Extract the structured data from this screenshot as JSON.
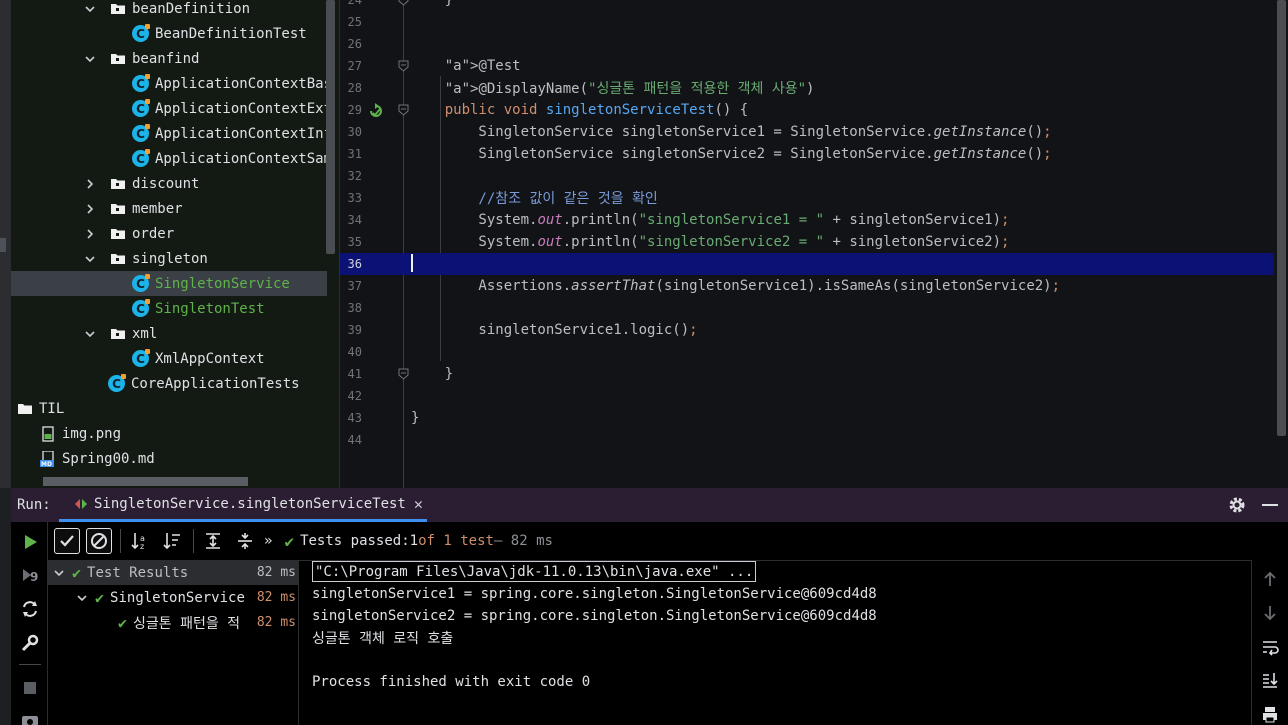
{
  "tree": {
    "items": [
      {
        "label": "beanDefinition",
        "type": "folder",
        "expanded": true,
        "indent": 1
      },
      {
        "label": "BeanDefinitionTest",
        "type": "class",
        "indent": 2
      },
      {
        "label": "beanfind",
        "type": "folder",
        "expanded": true,
        "indent": 1
      },
      {
        "label": "ApplicationContextBasi",
        "type": "class",
        "indent": 2
      },
      {
        "label": "ApplicationContextExte",
        "type": "class",
        "indent": 2
      },
      {
        "label": "ApplicationContextInfo",
        "type": "class",
        "indent": 2
      },
      {
        "label": "ApplicationContextSam",
        "type": "class",
        "indent": 2
      },
      {
        "label": "discount",
        "type": "folder",
        "expanded": false,
        "indent": 1
      },
      {
        "label": "member",
        "type": "folder",
        "expanded": false,
        "indent": 1
      },
      {
        "label": "order",
        "type": "folder",
        "expanded": false,
        "indent": 1
      },
      {
        "label": "singleton",
        "type": "folder",
        "expanded": true,
        "indent": 1
      },
      {
        "label": "SingletonService",
        "type": "class",
        "indent": 2,
        "green": true,
        "selected": true
      },
      {
        "label": "SingletonTest",
        "type": "class",
        "indent": 2,
        "green": true
      },
      {
        "label": "xml",
        "type": "folder",
        "expanded": true,
        "indent": 1
      },
      {
        "label": "XmlAppContext",
        "type": "class",
        "indent": 2
      },
      {
        "label": "CoreApplicationTests",
        "type": "class",
        "indent": 1.5
      },
      {
        "label": "TIL",
        "type": "rootfolder",
        "indent": 0
      },
      {
        "label": "img.png",
        "type": "image",
        "indent": 0.5
      },
      {
        "label": "Spring00.md",
        "type": "markdown",
        "indent": 0.5
      }
    ]
  },
  "editor": {
    "current_line": "36",
    "lines": [
      {
        "n": "24",
        "code": "    }"
      },
      {
        "n": "25",
        "code": ""
      },
      {
        "n": "26",
        "code": ""
      },
      {
        "n": "27",
        "code": "    @Test"
      },
      {
        "n": "28",
        "code": "    @DisplayName(\"싱글톤 패턴을 적용한 객체 사용\")"
      },
      {
        "n": "29",
        "code": "    public void singletonServiceTest() {"
      },
      {
        "n": "30",
        "code": "        SingletonService singletonService1 = SingletonService.getInstance();"
      },
      {
        "n": "31",
        "code": "        SingletonService singletonService2 = SingletonService.getInstance();"
      },
      {
        "n": "32",
        "code": ""
      },
      {
        "n": "33",
        "code": "        //참조 값이 같은 것을 확인"
      },
      {
        "n": "34",
        "code": "        System.out.println(\"singletonService1 = \" + singletonService1);"
      },
      {
        "n": "35",
        "code": "        System.out.println(\"singletonService2 = \" + singletonService2);"
      },
      {
        "n": "36",
        "code": ""
      },
      {
        "n": "37",
        "code": "        Assertions.assertThat(singletonService1).isSameAs(singletonService2);"
      },
      {
        "n": "38",
        "code": ""
      },
      {
        "n": "39",
        "code": "        singletonService1.logic();"
      },
      {
        "n": "40",
        "code": ""
      },
      {
        "n": "41",
        "code": "    }"
      },
      {
        "n": "42",
        "code": ""
      },
      {
        "n": "43",
        "code": "}"
      },
      {
        "n": "44",
        "code": ""
      }
    ]
  },
  "run": {
    "label": "Run:",
    "tab_title": "SingletonService.singletonServiceTest",
    "status": {
      "prefix": "Tests passed: ",
      "count": "1",
      "of": " of 1 test",
      "time": " – 82 ms"
    },
    "results": [
      {
        "name": "Test Results",
        "time": "82 ms",
        "level": 0,
        "selected": true
      },
      {
        "name": "SingletonService",
        "time": "82 ms",
        "level": 1
      },
      {
        "name": "싱글톤 패턴을 적",
        "time": "82 ms",
        "level": 2
      }
    ],
    "console": [
      "\"C:\\Program Files\\Java\\jdk-11.0.13\\bin\\java.exe\" ...",
      "singletonService1 = spring.core.singleton.SingletonService@609cd4d8",
      "singletonService2 = spring.core.singleton.SingletonService@609cd4d8",
      "싱글톤 객체 로직 호출",
      "",
      "Process finished with exit code 0"
    ]
  },
  "colors": {
    "run_header_bg": "#2b1e33",
    "current_line_bg": "#0c1175",
    "pass_green": "#5fb34a",
    "keyword": "#cf8e6d",
    "string": "#6aab73",
    "annotation": "#b3ae60",
    "method": "#56a8f5"
  }
}
